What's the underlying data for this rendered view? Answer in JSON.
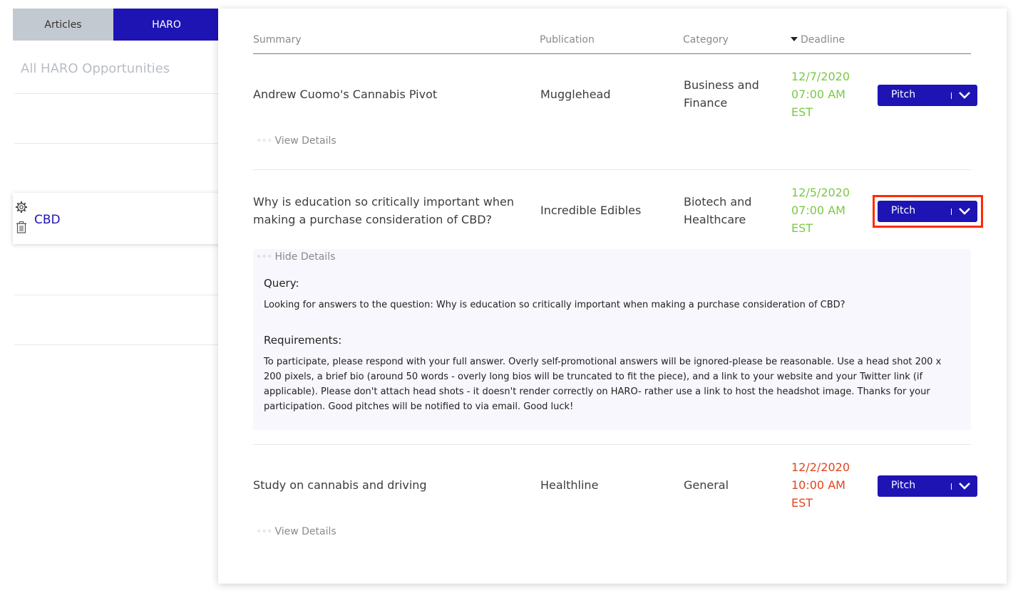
{
  "sidebar": {
    "tabs": [
      {
        "label": "Articles"
      },
      {
        "label": "HARO"
      }
    ],
    "title": "All HARO Opportunities",
    "selected_item": "CBD"
  },
  "table": {
    "headers": {
      "summary": "Summary",
      "publication": "Publication",
      "category": "Category",
      "deadline": "Deadline"
    },
    "rows": [
      {
        "summary": "Andrew Cuomo's Cannabis Pivot",
        "publication": "Mugglehead",
        "category": "Business and Finance",
        "deadline_date": "12/7/2020",
        "deadline_time": "07:00 AM",
        "deadline_tz": "EST",
        "details_toggle": "View Details",
        "pitch_label": "Pitch"
      },
      {
        "summary": "Why is education so critically important when making a purchase consideration of CBD?",
        "publication": "Incredible Edibles",
        "category": "Biotech and Healthcare",
        "deadline_date": "12/5/2020",
        "deadline_time": "07:00 AM",
        "deadline_tz": "EST",
        "details_toggle": "Hide Details",
        "pitch_label": "Pitch",
        "query_label": "Query:",
        "query": "Looking for answers to the question: Why is education so critically important when making a purchase consideration of CBD?",
        "requirements_label": "Requirements:",
        "requirements": "To participate, please respond with your full answer. Overly self-promotional answers will be ignored-please be reasonable. Use a head shot 200 x 200 pixels, a brief bio (around 50 words - overly long bios will be truncated to fit the piece), and a link to your website and your Twitter link (if applicable). Please don't attach head shots - it doesn't render correctly on HARO- rather use a link to host the headshot image. Thanks for your participation. Good pitches will be notified to via email. Good luck!"
      },
      {
        "summary": "Study on cannabis and driving",
        "publication": "Healthline",
        "category": "General",
        "deadline_date": "12/2/2020",
        "deadline_time": "10:00 AM",
        "deadline_tz": "EST",
        "details_toggle": "View Details",
        "pitch_label": "Pitch"
      }
    ]
  },
  "colors": {
    "accent": "#1e14b4",
    "deadline_ok": "#7ac943",
    "deadline_urgent": "#e0451f",
    "highlight": "#ff2a00"
  }
}
